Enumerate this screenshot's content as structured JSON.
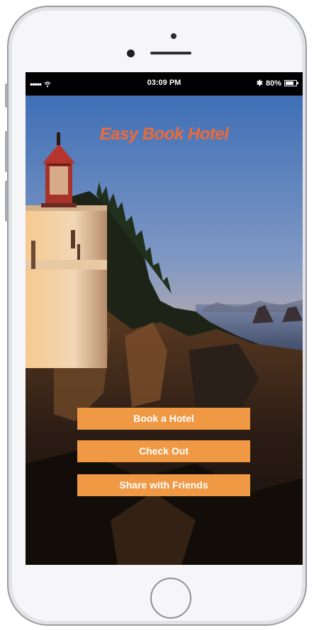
{
  "status_bar": {
    "signal": "•••••",
    "time": "03:09 PM",
    "bluetooth": "✱",
    "battery_text": "80%",
    "battery_level": 0.8
  },
  "app": {
    "title": "Easy Book Hotel",
    "title_color": "#ef6a35",
    "button_color": "#ef9945"
  },
  "buttons": {
    "book": "Book a Hotel",
    "checkout": "Check Out",
    "share": "Share with Friends"
  },
  "icons": {
    "wifi": "wifi-icon",
    "bluetooth": "bluetooth-icon",
    "battery": "battery-icon"
  }
}
